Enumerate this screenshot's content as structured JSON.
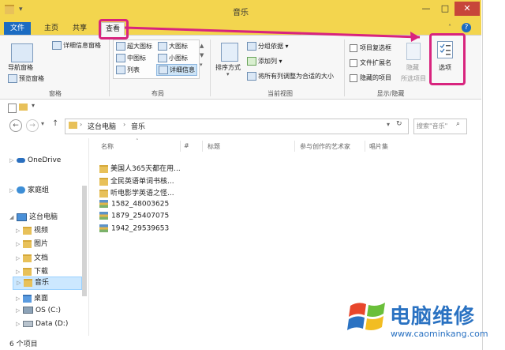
{
  "window": {
    "title": "音乐",
    "controls": {
      "minimize": "—",
      "maximize": "□",
      "close": "✕"
    }
  },
  "tabs": {
    "file": "文件",
    "home": "主页",
    "share": "共享",
    "view": "查看"
  },
  "help_icon": "?",
  "ribbon": {
    "panes": {
      "nav_pane": "导航窗格",
      "preview_pane": "预览窗格",
      "details_pane": "详细信息窗格",
      "group_label": "窗格"
    },
    "layout": {
      "items": [
        "超大图标",
        "大图标",
        "中图标",
        "小图标",
        "列表",
        "详细信息"
      ],
      "group_label": "布局"
    },
    "current_view": {
      "sort": "排序方式",
      "group_by": "分组依据",
      "add_column": "添加列",
      "fit_columns": "将所有列调整为合适的大小",
      "group_label": "当前视图"
    },
    "show_hide": {
      "checkbox_items": "项目复选框",
      "file_extensions": "文件扩展名",
      "hidden_items": "隐藏的项目",
      "hide": "隐藏",
      "hide_selected": "所选项目",
      "group_label": "显示/隐藏"
    },
    "options": "选项"
  },
  "addressbar": {
    "breadcrumb": [
      "这台电脑",
      "音乐"
    ],
    "search_placeholder": "搜索\"音乐\""
  },
  "columns": [
    "名称",
    "#",
    "标题",
    "参与创作的艺术家",
    "唱片集"
  ],
  "files": [
    {
      "name": "美国人365天都在用...",
      "type": "folder"
    },
    {
      "name": "全民英语单词书核...",
      "type": "folder"
    },
    {
      "name": "听电影学英语之怪...",
      "type": "folder"
    },
    {
      "name": "1582_48003625",
      "type": "archive"
    },
    {
      "name": "1879_25407075",
      "type": "archive"
    },
    {
      "name": "1942_29539653",
      "type": "archive"
    }
  ],
  "nav": {
    "onedrive": "OneDrive",
    "homegroup": "家庭组",
    "this_pc": "这台电脑",
    "children": [
      "视频",
      "图片",
      "文档",
      "下载",
      "音乐",
      "桌面",
      "OS (C:)",
      "Data (D:)"
    ]
  },
  "status": {
    "count": "6 个项目"
  },
  "watermark": {
    "brand": "电脑维修",
    "url": "www.caominkang.com"
  },
  "colors": {
    "highlight": "#d8247e",
    "titlebar": "#f3d54e",
    "file_tab": "#1b6bc1"
  }
}
